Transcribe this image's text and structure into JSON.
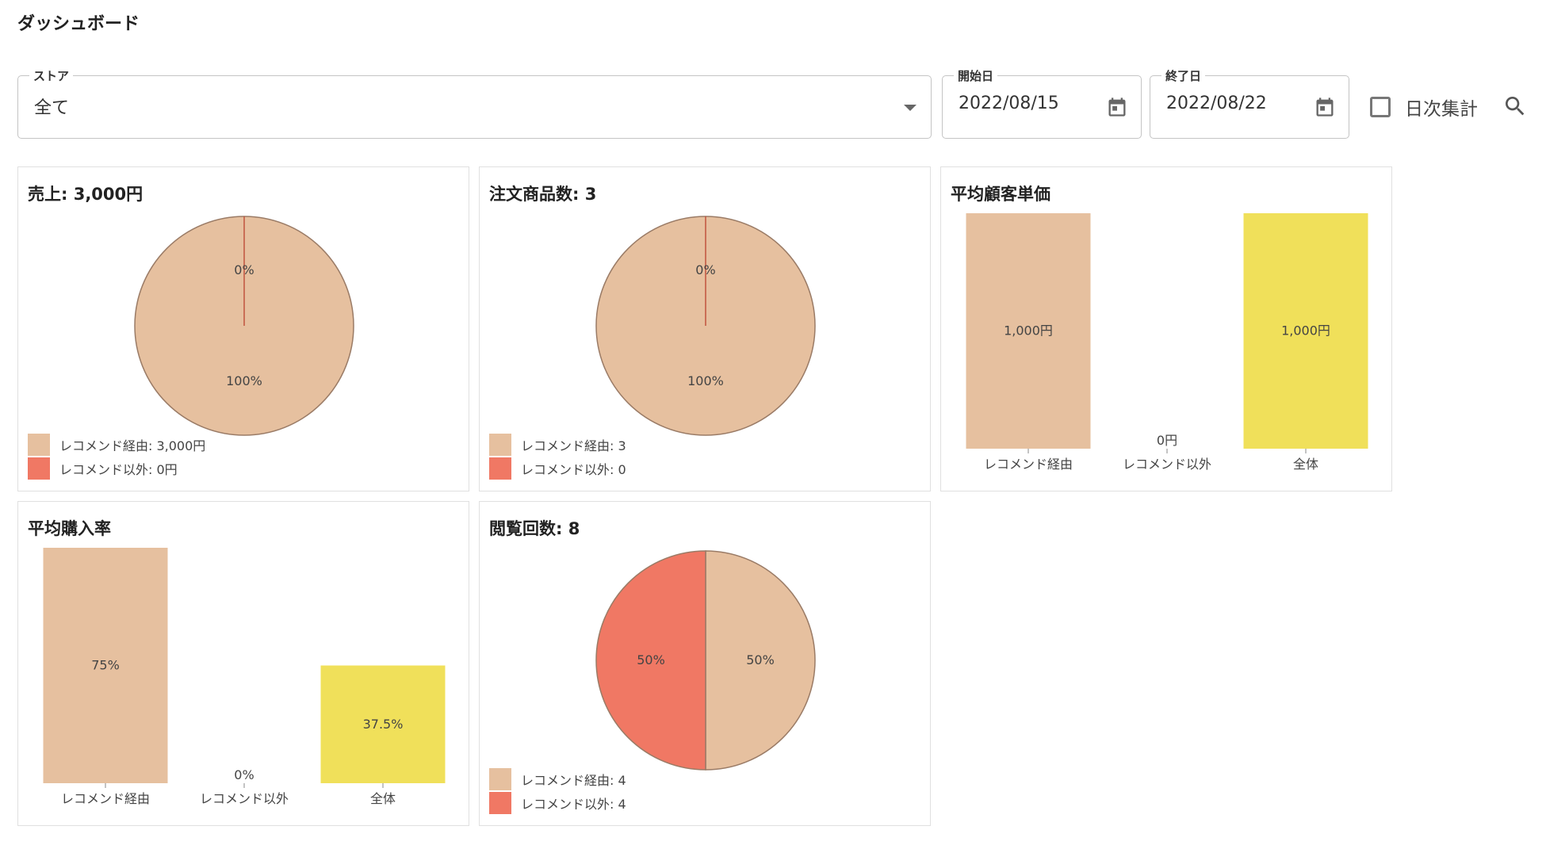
{
  "page": {
    "title": "ダッシュボード"
  },
  "filters": {
    "store": {
      "label": "ストア",
      "value": "全て"
    },
    "start_date": {
      "label": "開始日",
      "value": "2022/08/15"
    },
    "end_date": {
      "label": "終了日",
      "value": "2022/08/22"
    },
    "daily": {
      "label": "日次集計",
      "checked": false
    }
  },
  "colors": {
    "recommend": "#E6C09F",
    "other": "#F07864",
    "total": "#F0E05A",
    "stroke": "#9a7b66"
  },
  "cards": {
    "sales": {
      "title": "売上: 3,000円",
      "legend": [
        "レコメンド経由: 3,000円",
        "レコメンド以外: 0円"
      ]
    },
    "orders": {
      "title": "注文商品数: 3",
      "legend": [
        "レコメンド経由: 3",
        "レコメンド以外: 0"
      ]
    },
    "avg_price": {
      "title": "平均顧客単価"
    },
    "avg_rate": {
      "title": "平均購入率"
    },
    "views": {
      "title": "閲覧回数: 8",
      "legend": [
        "レコメンド経由: 4",
        "レコメンド以外: 4"
      ]
    }
  },
  "chart_data": [
    {
      "type": "pie",
      "id": "sales",
      "labels": [
        "レコメンド経由",
        "レコメンド以外"
      ],
      "values": [
        3000,
        0
      ],
      "slice_labels": [
        "100%",
        "0%"
      ]
    },
    {
      "type": "pie",
      "id": "orders",
      "labels": [
        "レコメンド経由",
        "レコメンド以外"
      ],
      "values": [
        3,
        0
      ],
      "slice_labels": [
        "100%",
        "0%"
      ]
    },
    {
      "type": "bar",
      "id": "avg_price",
      "categories": [
        "レコメンド経由",
        "レコメンド以外",
        "全体"
      ],
      "values": [
        1000,
        0,
        1000
      ],
      "value_labels": [
        "1,000円",
        "0円",
        "1,000円"
      ],
      "ylim": [
        0,
        1000
      ]
    },
    {
      "type": "bar",
      "id": "avg_rate",
      "categories": [
        "レコメンド経由",
        "レコメンド以外",
        "全体"
      ],
      "values": [
        75,
        0,
        37.5
      ],
      "value_labels": [
        "75%",
        "0%",
        "37.5%"
      ],
      "ylim": [
        0,
        75
      ]
    },
    {
      "type": "pie",
      "id": "views",
      "labels": [
        "レコメンド経由",
        "レコメンド以外"
      ],
      "values": [
        4,
        4
      ],
      "slice_labels": [
        "50%",
        "50%"
      ]
    }
  ]
}
